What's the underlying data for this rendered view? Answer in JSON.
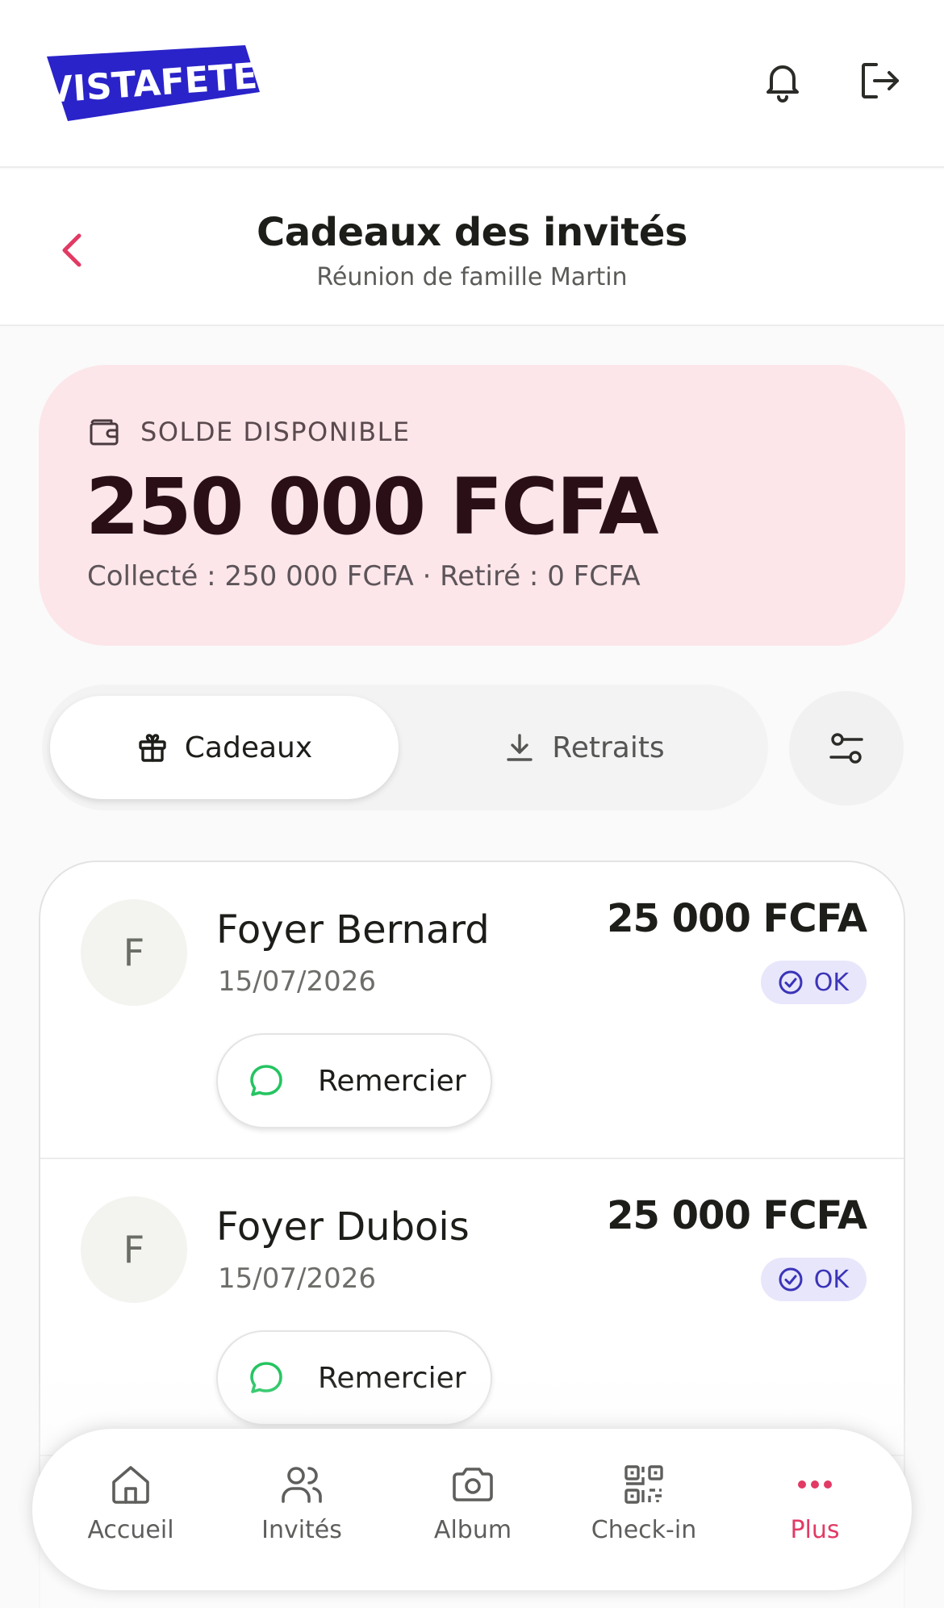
{
  "app": {
    "logo_text": "VISTAFETE",
    "brand_color": "#2a23c9",
    "accent_color": "#e23a64"
  },
  "topbar": {
    "notifications_icon": "bell-icon",
    "logout_icon": "logout-icon"
  },
  "header": {
    "back_icon": "chevron-left-icon",
    "title": "Cadeaux des invités",
    "subtitle": "Réunion de famille Martin"
  },
  "balance": {
    "icon": "wallet-icon",
    "label": "SOLDE DISPONIBLE",
    "amount": "250 000 FCFA",
    "meta": "Collecté : 250 000 FCFA · Retiré : 0 FCFA"
  },
  "tabs": [
    {
      "label": "Cadeaux",
      "icon": "gift-icon",
      "active": true
    },
    {
      "label": "Retraits",
      "icon": "download-icon",
      "active": false
    }
  ],
  "filter_icon": "sliders-icon",
  "gifts": [
    {
      "initial": "F",
      "name": "Foyer Bernard",
      "date": "15/07/2026",
      "amount": "25 000 FCFA",
      "status": "OK",
      "action_label": "Remercier"
    },
    {
      "initial": "F",
      "name": "Foyer Dubois",
      "date": "15/07/2026",
      "amount": "25 000 FCFA",
      "status": "OK",
      "action_label": "Remercier"
    }
  ],
  "nav": [
    {
      "label": "Accueil",
      "icon": "home-icon",
      "active": false
    },
    {
      "label": "Invités",
      "icon": "users-icon",
      "active": false
    },
    {
      "label": "Album",
      "icon": "camera-icon",
      "active": false
    },
    {
      "label": "Check-in",
      "icon": "qr-code-icon",
      "active": false
    },
    {
      "label": "Plus",
      "icon": "more-dots-icon",
      "active": true
    }
  ]
}
